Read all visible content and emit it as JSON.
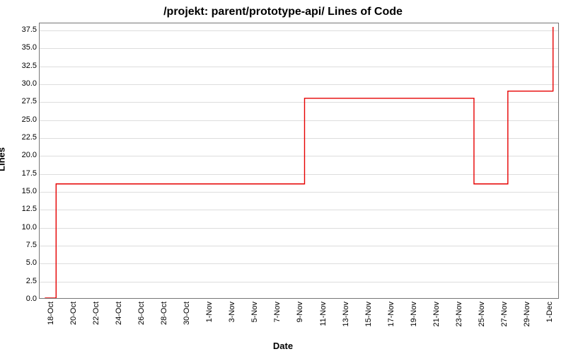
{
  "chart_data": {
    "type": "line",
    "title": "/projekt: parent/prototype-api/ Lines of Code",
    "xlabel": "Date",
    "ylabel": "Lines",
    "ylim": [
      0,
      38.5
    ],
    "y_ticks": [
      0.0,
      2.5,
      5.0,
      7.5,
      10.0,
      12.5,
      15.0,
      17.5,
      20.0,
      22.5,
      25.0,
      27.5,
      30.0,
      32.5,
      35.0,
      37.5
    ],
    "x_categories": [
      "18-Oct",
      "20-Oct",
      "22-Oct",
      "24-Oct",
      "26-Oct",
      "28-Oct",
      "30-Oct",
      "1-Nov",
      "3-Nov",
      "5-Nov",
      "7-Nov",
      "9-Nov",
      "11-Nov",
      "13-Nov",
      "15-Nov",
      "17-Nov",
      "19-Nov",
      "21-Nov",
      "23-Nov",
      "25-Nov",
      "27-Nov",
      "29-Nov",
      "1-Dec"
    ],
    "step_interpolation": "hv",
    "series": [
      {
        "name": "Lines of Code",
        "color": "#e60000",
        "points": [
          {
            "x": "18-Oct",
            "y": 0
          },
          {
            "x": "19-Oct",
            "y": 16
          },
          {
            "x": "10-Nov",
            "y": 16
          },
          {
            "x": "10-Nov",
            "y": 28
          },
          {
            "x": "25-Nov",
            "y": 28
          },
          {
            "x": "25-Nov",
            "y": 16
          },
          {
            "x": "28-Nov",
            "y": 16
          },
          {
            "x": "28-Nov",
            "y": 29
          },
          {
            "x": "2-Dec",
            "y": 29
          },
          {
            "x": "2-Dec",
            "y": 38
          }
        ]
      }
    ]
  }
}
